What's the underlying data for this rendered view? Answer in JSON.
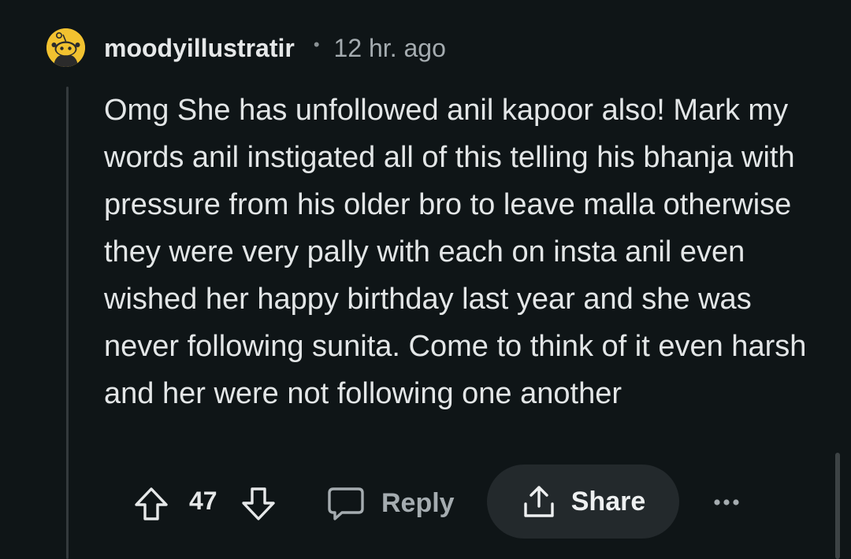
{
  "comment": {
    "author": "moodyillustratir",
    "separator": "•",
    "timestamp": "12 hr. ago",
    "body": "Omg She has unfollowed anil kapoor also! Mark my words anil instigated all of this telling his bhanja with pressure from his older bro to leave malla otherwise they were very pally with each on insta anil even wished her happy birthday last year and she was never following sunita. Come to think of it even harsh and her were not following one another",
    "score": "47"
  },
  "actions": {
    "reply_label": "Reply",
    "share_label": "Share"
  },
  "icons": {
    "avatar": "snoo-avatar-icon",
    "upvote": "arrow-up-icon",
    "downvote": "arrow-down-icon",
    "reply": "speech-bubble-icon",
    "share": "share-upload-icon",
    "more": "more-dots-icon"
  },
  "colors": {
    "background": "#0f1517",
    "avatar": "#f2c230",
    "share_button_bg": "#23292c"
  }
}
